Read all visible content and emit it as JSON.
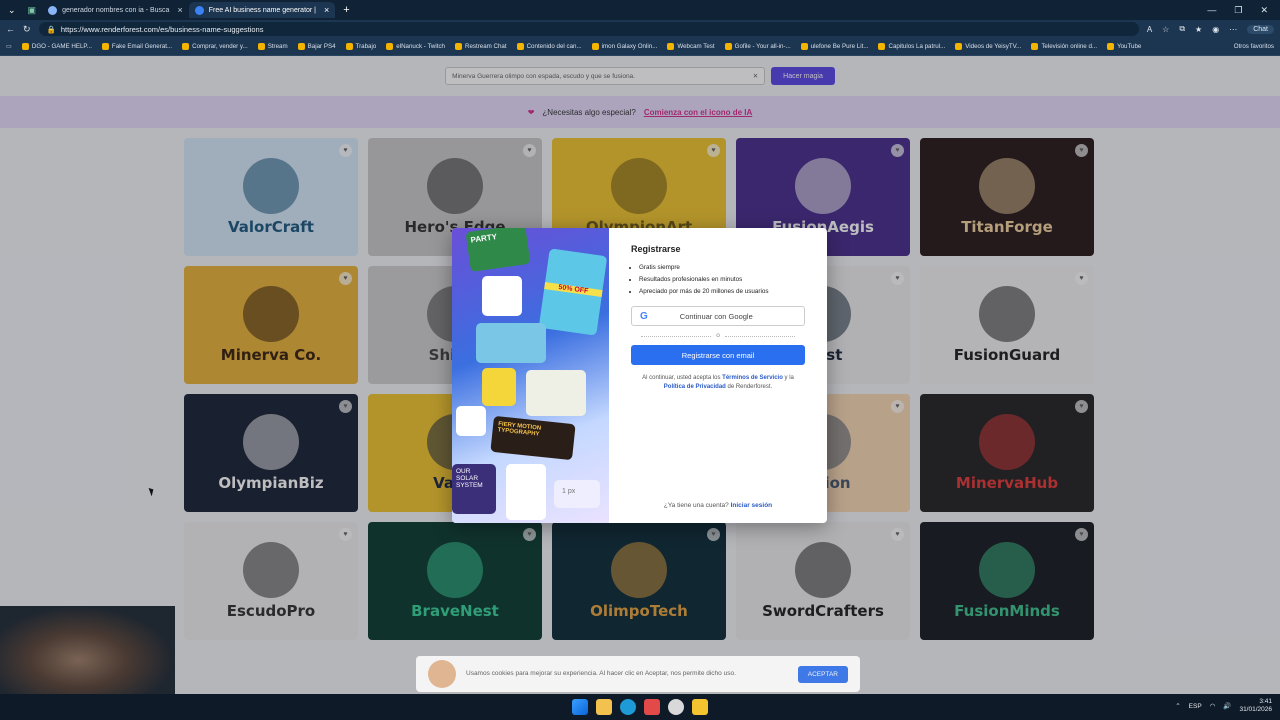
{
  "browser": {
    "tabs": [
      {
        "label": "generador nombres con ia - Busca"
      },
      {
        "label": "Free AI business name generator |"
      }
    ],
    "new_tab": "+",
    "url": "https://www.renderforest.com/es/business-name-suggestions",
    "chat_label": "Chat",
    "bookmarks": [
      "DGO - GAME HELP...",
      "Fake Email Generat...",
      "Comprar, vender y...",
      "Stream",
      "Bajar PS4",
      "Trabajo",
      "elNanuck - Twitch",
      "Restream Chat",
      "Contenido del can...",
      "imon Galaxy Onlin...",
      "Webcam Test",
      "Gofile - Your all-in-...",
      "ulefone Be Pure Lit...",
      "Capitulos La patrul...",
      "Videos de YeisyTV...",
      "Televisión online d...",
      "YouTube"
    ],
    "other_favs": "Otros favoritos"
  },
  "search": {
    "placeholder": "Minerva Guerrera olimpo con espada, escudo y que se fusiona.",
    "button": "Hacer magia"
  },
  "promo": {
    "text": "¿Necesitas algo especial?",
    "link": "Comienza con el icono de IA"
  },
  "cards": [
    {
      "name": "ValorCraft",
      "bg": "#d6e8f7",
      "color": "#1e5a82"
    },
    {
      "name": "Hero's Edge",
      "bg": "#c9c9c9",
      "color": "#333"
    },
    {
      "name": "OlympionArt",
      "bg": "#f0c531",
      "color": "#6d5a18"
    },
    {
      "name": "FusionAegis",
      "bg": "#4a2f8c",
      "color": "#fff"
    },
    {
      "name": "TitanForge",
      "bg": "#2a1b1b",
      "color": "#f2d3a0"
    },
    {
      "name": "Minerva Co.",
      "bg": "#e8b33a",
      "color": "#3b2410"
    },
    {
      "name": "Shield",
      "bg": "#cfcfcf",
      "color": "#444"
    },
    {
      "name": "",
      "bg": "#e9e9e9",
      "color": "#333"
    },
    {
      "name": "Nest",
      "bg": "#eeeeee",
      "color": "#1d2b3d"
    },
    {
      "name": "FusionGuard",
      "bg": "#f2f2f2",
      "color": "#222"
    },
    {
      "name": "OlympianBiz",
      "bg": "#1b2436",
      "color": "#fff"
    },
    {
      "name": "Valor",
      "bg": "#f0c531",
      "color": "#1e2a48"
    },
    {
      "name": "",
      "bg": "#eeeeee",
      "color": "#333"
    },
    {
      "name": "Fusion",
      "bg": "#f6d7b3",
      "color": "#4a5a70"
    },
    {
      "name": "MinervaHub",
      "bg": "#262626",
      "color": "#e43b3b"
    },
    {
      "name": "EscudoPro",
      "bg": "#efefef",
      "color": "#333"
    },
    {
      "name": "BraveNest",
      "bg": "#0f3d34",
      "color": "#3ad39a"
    },
    {
      "name": "OlimpoTech",
      "bg": "#0f2d3a",
      "color": "#e8a640"
    },
    {
      "name": "SwordCrafters",
      "bg": "#eeeeee",
      "color": "#222"
    },
    {
      "name": "FusionMinds",
      "bg": "#1a1f24",
      "color": "#3fc48e"
    }
  ],
  "modal": {
    "title": "Registrarse",
    "bullets": [
      "Gratis siempre",
      "Resultados profesionales en minutos",
      "Apreciado por más de 20 millones de usuarios"
    ],
    "google": "Continuar con Google",
    "or": "o",
    "email": "Registrarse con email",
    "legal_pre": "Al continuar, usted acepta los",
    "terms": "Términos de Servicio",
    "and": "y la",
    "privacy": "Política de Privacidad",
    "legal_post": "de Renderforest.",
    "login_q": "¿Ya tiene una cuenta?",
    "login_link": "Iniciar sesión",
    "art_labels": [
      "PARTY",
      "50% OFF",
      "FIERY MOTION TYPOGRAPHY",
      "OUR SOLAR SYSTEM",
      "1 px"
    ]
  },
  "cookie": {
    "text": "Usamos cookies para mejorar su experiencia. Al hacer clic en Aceptar, nos permite dicho uso.",
    "button": "ACEPTAR"
  },
  "taskbar": {
    "lang": "ESP",
    "time": "3:41",
    "date": "31/01/2026"
  }
}
